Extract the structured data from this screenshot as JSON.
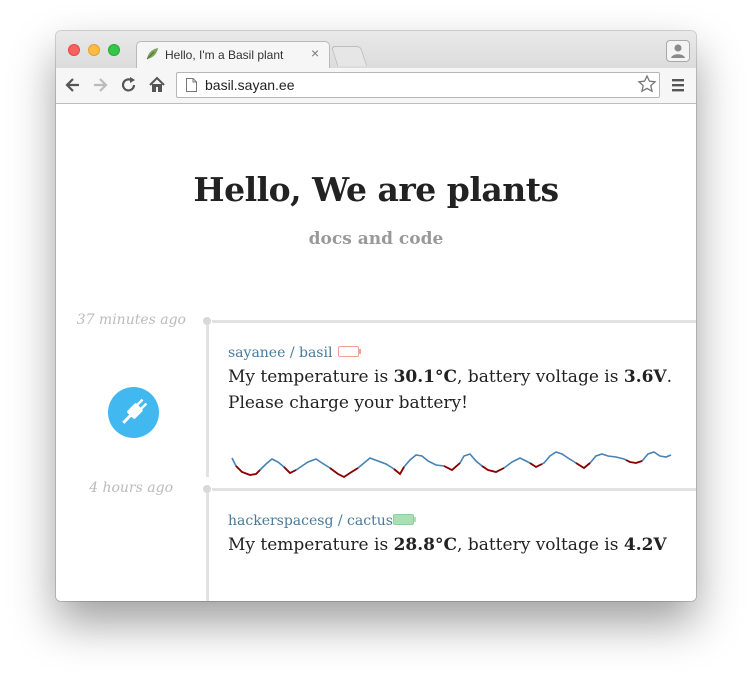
{
  "browser": {
    "tab_title": "Hello, I'm a Basil plant",
    "tab_close": "×",
    "url": "basil.sayan.ee"
  },
  "page": {
    "heading": "Hello, We are plants",
    "subheading": "docs and code"
  },
  "feed": [
    {
      "time": "37 minutes ago",
      "repo": "sayanee / basil",
      "battery_level": "low",
      "battery_color": "#f0a090",
      "message_prefix": "My temperature is ",
      "temperature": "30.1°C",
      "message_mid": ", battery voltage is ",
      "voltage": "3.6V",
      "message_suffix": ".",
      "notice": "Please charge your battery!",
      "icon": "plug-icon",
      "icon_color": "#41b8ef",
      "sparkline_colors": [
        "#4682b4",
        "#8b0000"
      ]
    },
    {
      "time": "4 hours ago",
      "repo": "hackerspacesg / cactus",
      "battery_level": "full",
      "battery_color": "#a9dfb3",
      "message_prefix": "My temperature is ",
      "temperature": "28.8°C",
      "message_mid": ", battery voltage is ",
      "voltage": "4.2V"
    }
  ]
}
